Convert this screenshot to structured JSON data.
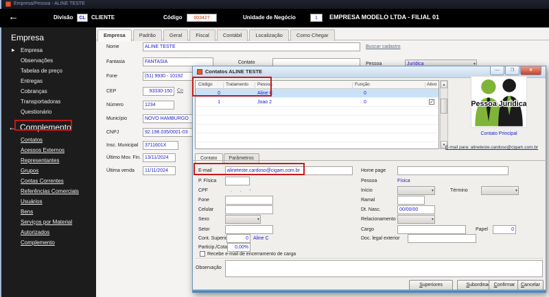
{
  "icons": {
    "back": "←",
    "play": "▶",
    "chevron": "▾",
    "check": "✓",
    "scroll_up": "▲",
    "scroll_down": "▼",
    "minimize": "—",
    "maximize": "❐",
    "close": "✕"
  },
  "window": {
    "title": "Empresa/Pessoa - ALINE TESTE"
  },
  "header": {
    "divisao_label": "Divisão",
    "divisao_code": "CL",
    "divisao_value": "CLIENTE",
    "codigo_label": "Código",
    "codigo_value": "003427",
    "unidade_label": "Unidade de Negócio",
    "unidade_value": "1",
    "empresa_value": "EMPRESA MODELO LTDA - FILIAL 01"
  },
  "sidebar": {
    "section1_title": "Empresa",
    "section1_items": [
      "Empresa",
      "Observações",
      "Tabelas de preço",
      "Entregas",
      "Cobranças",
      "Transportadoras",
      "Questionário"
    ],
    "section2_title": "Complemento",
    "section2_items": [
      "Contatos",
      "Acessos Externos",
      "Representantes",
      "Grupos",
      "Contas Correntes",
      "Referências Comerciais",
      "Usuários",
      "Bens",
      "Serviços por Material",
      "Autorizados",
      "Complemento"
    ]
  },
  "main": {
    "tabs": [
      "Empresa",
      "Padrão",
      "Geral",
      "Fiscal",
      "Contábil",
      "Localização",
      "Como Chegar"
    ],
    "fields": {
      "nome_label": "Nome",
      "nome_value": "ALINE TESTE",
      "fantasia_label": "Fantasia",
      "fantasia_value": "FANTASIA",
      "contato_label": "Contato",
      "buscar_link": "Buscar cadastro",
      "pessoa_label": "Pessoa",
      "pessoa_value": "Jurídica",
      "fone_label": "Fone",
      "fone_value": "(51) 9930 - 10192",
      "cep_label": "CEP",
      "cep_value": "93330-150",
      "cep_link": "Co",
      "numero_label": "Número",
      "numero_value": "1234",
      "municipio_label": "Município",
      "municipio_value": "NOVO HAMBURGO",
      "cnpj_label": "CNPJ",
      "cnpj_value": "92.198.035/0001-03",
      "insc_label": "Insc. Municipal",
      "insc_value": "3711601X",
      "ultimo_mov_label": "Último Mov. Fin.",
      "ultimo_mov_value": "13/11/2024",
      "ultima_venda_label": "Última venda",
      "ultima_venda_value": "11/11/2024"
    }
  },
  "dialog": {
    "title": "Contatos ALINE TESTE",
    "grid": {
      "columns": [
        "Código",
        "Tratamento",
        "Pessoa",
        "Função",
        "Ativo"
      ],
      "rows": [
        {
          "codigo": "0",
          "tratamento": "",
          "pessoa": "Aline C",
          "funcao": "0",
          "ativo": false
        },
        {
          "codigo": "1",
          "tratamento": "",
          "pessoa": "Joao 2",
          "funcao": "0",
          "ativo": true
        }
      ]
    },
    "image_caption": "Pessoa Juridica",
    "contato_principal_link": "Contato Principal",
    "email_para_link": "E-mail para: alineteste.cardoso@cigam.com.br",
    "tabs": [
      "Contato",
      "Parâmetros"
    ],
    "form": {
      "email_label": "E-mail",
      "email_value": "alineteste.cardoso@cigam.com.br",
      "pfisica_label": "P. Física",
      "cpf_label": "CPF",
      "cpf_mask": ".      .      -",
      "fone_label": "Fone",
      "celular_label": "Celular",
      "sexo_label": "Sexo",
      "setor_label": "Setor",
      "cont_superior_label": "Cont. Superior",
      "cont_superior_value": "0",
      "cont_superior_name": "Aline C",
      "particip_label": "Particip./Cotas",
      "particip_value": "0,00%",
      "checkbox_label": "Recebe e-mail de encerramento de carga",
      "homepage_label": "Home page",
      "pessoa_label": "Pessoa",
      "pessoa_value": "Física",
      "inicio_label": "Início",
      "termino_label": "Término",
      "ramal_label": "Ramal",
      "dtnasc_label": "Dt. Nasc.",
      "dtnasc_value": "00/00/00",
      "relacionamento_label": "Relacionamento",
      "cargo_label": "Cargo",
      "papel_label": "Papel",
      "papel_value": "0",
      "doc_legal_label": "Doc. legal exterior",
      "observacao_label": "Observação"
    },
    "buttons": [
      "Superiores",
      "Subordinados",
      "Confirmar",
      "Cancelar"
    ]
  }
}
